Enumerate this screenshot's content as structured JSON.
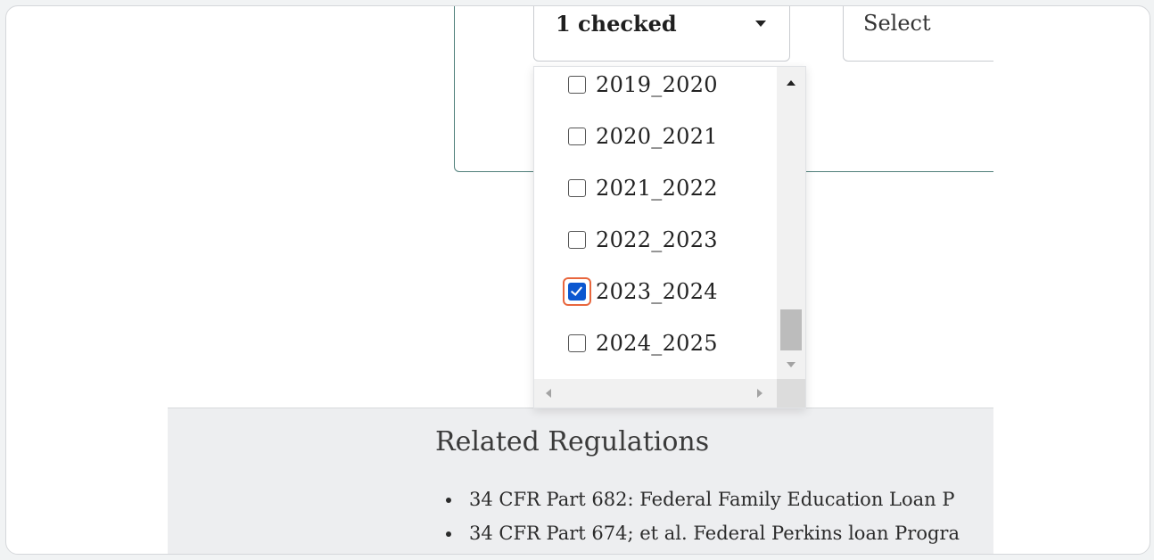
{
  "filters": {
    "years_select_value": "1 checked",
    "other_select_value": "Select"
  },
  "year_options": [
    {
      "label": "2019_2020",
      "checked": false
    },
    {
      "label": "2020_2021",
      "checked": false
    },
    {
      "label": "2021_2022",
      "checked": false
    },
    {
      "label": "2022_2023",
      "checked": false
    },
    {
      "label": "2023_2024",
      "checked": true
    },
    {
      "label": "2024_2025",
      "checked": false
    }
  ],
  "related": {
    "title": "Related Regulations",
    "items": [
      "34 CFR Part 682: Federal Family Education Loan P",
      "34 CFR Part 674; et al. Federal Perkins loan Progra"
    ]
  },
  "colors": {
    "accent": "#0b57d0",
    "focus_ring": "#e8663d",
    "panel_border": "#4f7f7a"
  }
}
